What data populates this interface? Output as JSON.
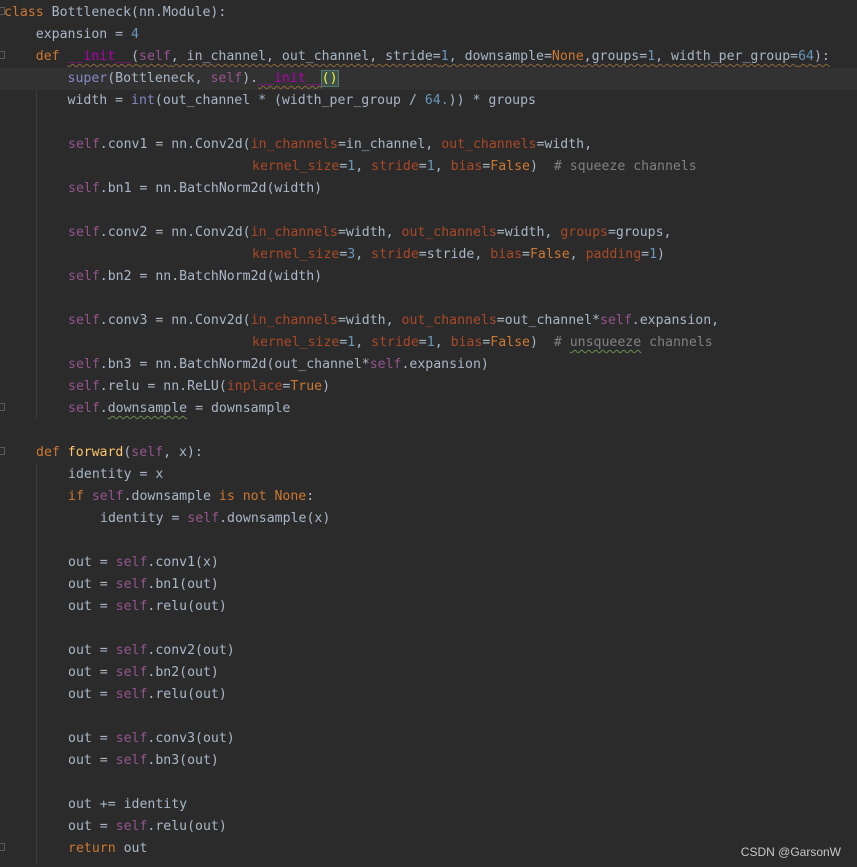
{
  "code": {
    "l1_class": "class",
    "l1_name": " Bottleneck(nn.Module):",
    "l2_a": "    expansion = ",
    "l2_num": "4",
    "l3_def": "    def ",
    "l3_init": "__init__",
    "l3_p1": "(",
    "l3_self": "self",
    "l3_rest": ", in_channel, out_channel, stride=",
    "l3_n1": "1",
    "l3_rest2": ", downsample=",
    "l3_none": "None",
    "l3_rest3": ",groups=",
    "l3_n2": "1",
    "l3_rest4": ", width_per_group=",
    "l3_n3": "64",
    "l3_end": "):",
    "l4_a": "        ",
    "l4_super": "super",
    "l4_b": "(Bottleneck, ",
    "l4_self": "self",
    "l4_c": ").",
    "l4_init": "__init__",
    "l4_paren": "()",
    "l5_a": "        width = ",
    "l5_int": "int",
    "l5_b": "(out_channel * (width_per_group / ",
    "l5_num": "64.",
    "l5_c": ")) * groups",
    "l7_self": "self",
    "l7_a": ".conv1 = nn.Conv2d(",
    "l7_p1": "in_channels",
    "l7_b": "=in_channel, ",
    "l7_p2": "out_channels",
    "l7_c": "=width,",
    "l8_p1": "kernel_size",
    "l8_a": "=",
    "l8_n1": "1",
    "l8_b": ", ",
    "l8_p2": "stride",
    "l8_c": "=",
    "l8_n2": "1",
    "l8_d": ", ",
    "l8_p3": "bias",
    "l8_e": "=",
    "l8_false": "False",
    "l8_f": ")  ",
    "l8_cm": "# squeeze channels",
    "l9_self": "self",
    "l9_a": ".bn1 = nn.BatchNorm2d(width)",
    "l11_self": "self",
    "l11_a": ".conv2 = nn.Conv2d(",
    "l11_p1": "in_channels",
    "l11_b": "=width, ",
    "l11_p2": "out_channels",
    "l11_c": "=width, ",
    "l11_p3": "groups",
    "l11_d": "=groups,",
    "l12_p1": "kernel_size",
    "l12_a": "=",
    "l12_n1": "3",
    "l12_b": ", ",
    "l12_p2": "stride",
    "l12_c": "=stride, ",
    "l12_p3": "bias",
    "l12_d": "=",
    "l12_false": "False",
    "l12_e": ", ",
    "l12_p4": "padding",
    "l12_f": "=",
    "l12_n2": "1",
    "l12_g": ")",
    "l13_self": "self",
    "l13_a": ".bn2 = nn.BatchNorm2d(width)",
    "l15_self": "self",
    "l15_a": ".conv3 = nn.Conv2d(",
    "l15_p1": "in_channels",
    "l15_b": "=width, ",
    "l15_p2": "out_channels",
    "l15_c": "=out_channel*",
    "l15_self2": "self",
    "l15_d": ".expansion,",
    "l16_p1": "kernel_size",
    "l16_a": "=",
    "l16_n1": "1",
    "l16_b": ", ",
    "l16_p2": "stride",
    "l16_c": "=",
    "l16_n2": "1",
    "l16_d": ", ",
    "l16_p3": "bias",
    "l16_e": "=",
    "l16_false": "False",
    "l16_f": ")  ",
    "l16_cm1": "# ",
    "l16_cm2": "unsqueeze",
    "l16_cm3": " channels",
    "l17_self": "self",
    "l17_a": ".bn3 = nn.BatchNorm2d(out_channel*",
    "l17_self2": "self",
    "l17_b": ".expansion)",
    "l18_self": "self",
    "l18_a": ".relu = nn.ReLU(",
    "l18_p1": "inplace",
    "l18_b": "=",
    "l18_true": "True",
    "l18_c": ")",
    "l19_self": "self",
    "l19_a": ".",
    "l19_ds": "downsample",
    "l19_b": " = downsample",
    "l21_def": "def ",
    "l21_fn": "forward",
    "l21_a": "(",
    "l21_self": "self",
    "l21_b": ", x):",
    "l22": "identity = x",
    "l23_if": "if ",
    "l23_self": "self",
    "l23_a": ".downsample ",
    "l23_is": "is not None",
    "l23_b": ":",
    "l24_a": "identity = ",
    "l24_self": "self",
    "l24_b": ".downsample(x)",
    "l26_a": "out = ",
    "l26_self": "self",
    "l26_b": ".conv1(x)",
    "l27_a": "out = ",
    "l27_self": "self",
    "l27_b": ".bn1(out)",
    "l28_a": "out = ",
    "l28_self": "self",
    "l28_b": ".relu(out)",
    "l30_a": "out = ",
    "l30_self": "self",
    "l30_b": ".conv2(out)",
    "l31_a": "out = ",
    "l31_self": "self",
    "l31_b": ".bn2(out)",
    "l32_a": "out = ",
    "l32_self": "self",
    "l32_b": ".relu(out)",
    "l34_a": "out = ",
    "l34_self": "self",
    "l34_b": ".conv3(out)",
    "l35_a": "out = ",
    "l35_self": "self",
    "l35_b": ".bn3(out)",
    "l37": "out += identity",
    "l38_a": "out = ",
    "l38_self": "self",
    "l38_b": ".relu(out)",
    "l39_ret": "return",
    "l39_a": " out"
  },
  "watermark": "CSDN @GarsonW",
  "colors": {
    "background": "#2b2b2b",
    "keyword": "#cc7832",
    "self": "#94558d",
    "number": "#6897bb",
    "param": "#aa4926",
    "function": "#ffc66d",
    "comment": "#808080"
  }
}
